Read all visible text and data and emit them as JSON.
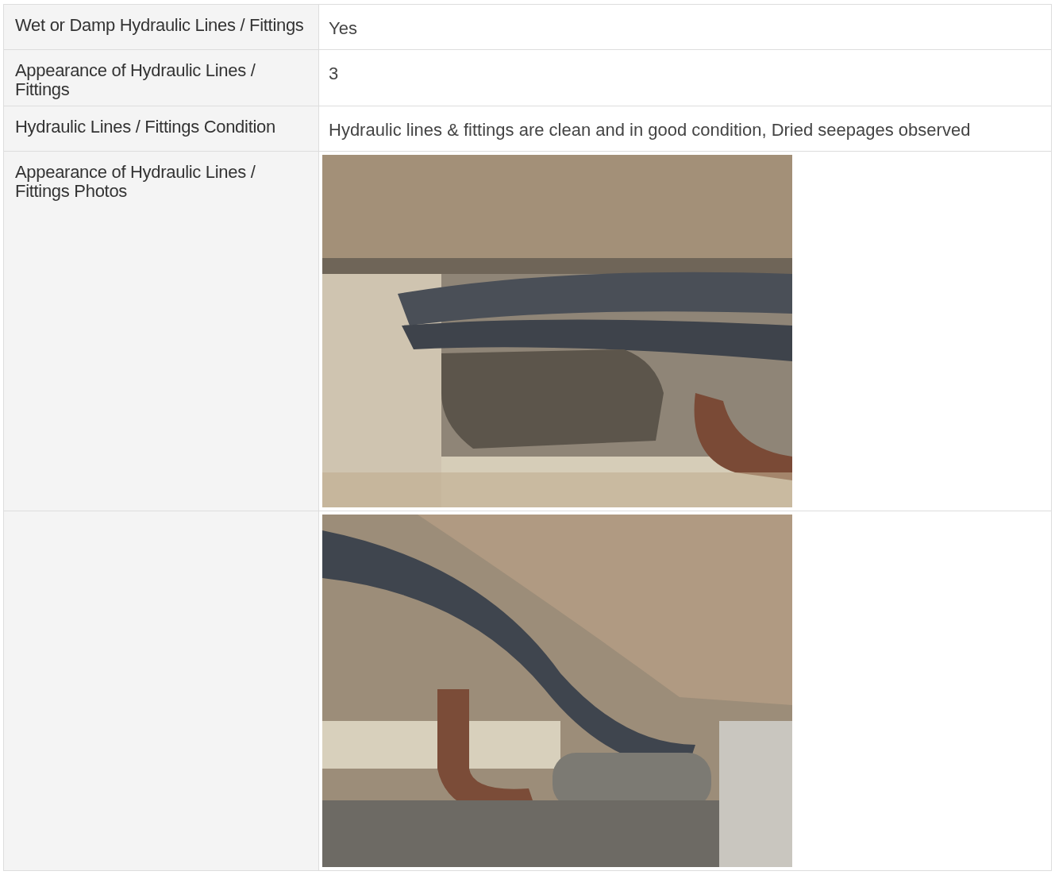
{
  "table": {
    "rows": [
      {
        "kind": "text",
        "label": "Wet or Damp Hydraulic Lines / Fittings",
        "value": "Yes"
      },
      {
        "kind": "text",
        "label": "Appearance of Hydraulic Lines / Fittings",
        "value": "3"
      },
      {
        "kind": "text",
        "label": "Hydraulic Lines / Fittings Condition",
        "value": "Hydraulic lines & fittings are clean and in good condition, Dried seepages observed"
      },
      {
        "label": "Appearance of Hydraulic Lines / Fittings Photos",
        "photo": {
          "kind": "picture"
        }
      },
      {
        "photo": {
          "kind": "picture"
        }
      }
    ]
  }
}
